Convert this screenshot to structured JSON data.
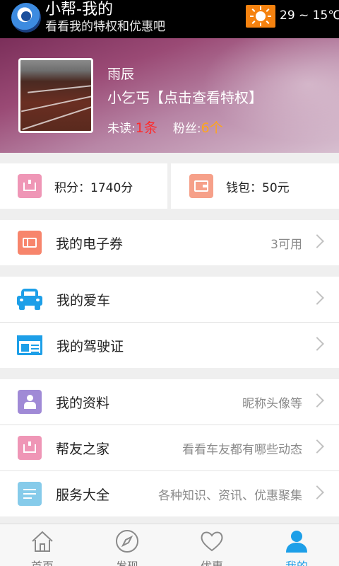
{
  "header": {
    "title": "小帮-我的",
    "subtitle": "看看我的特权和优惠吧",
    "weather_icon": "sun-icon",
    "weather_color": "#f5820f",
    "temperature": "29 ~ 15℃"
  },
  "profile": {
    "name": "雨辰",
    "level": "小乞丐【点击查看特权】",
    "unread_label": "未读:",
    "unread_value": "1条",
    "fans_label": "粉丝:",
    "fans_value": "6个"
  },
  "wallet": {
    "points": "积分：1740分",
    "wallet": "钱包：50元"
  },
  "menu": {
    "coupons": {
      "label": "我的电子券",
      "hint": "3可用"
    },
    "car": {
      "label": "我的爱车"
    },
    "license": {
      "label": "我的驾驶证"
    },
    "profile_info": {
      "label": "我的资料",
      "hint": "昵称头像等"
    },
    "friends": {
      "label": "帮友之家",
      "hint": "看看车友都有哪些动态"
    },
    "services": {
      "label": "服务大全",
      "hint": "各种知识、资讯、优惠聚集"
    }
  },
  "nav": {
    "tabs": [
      {
        "label": "首页",
        "icon": "home-icon"
      },
      {
        "label": "发现",
        "icon": "compass-icon"
      },
      {
        "label": "优惠",
        "icon": "heart-icon"
      },
      {
        "label": "我的",
        "icon": "user-icon"
      }
    ],
    "active_index": 3,
    "active_color": "#1d9fe8"
  }
}
